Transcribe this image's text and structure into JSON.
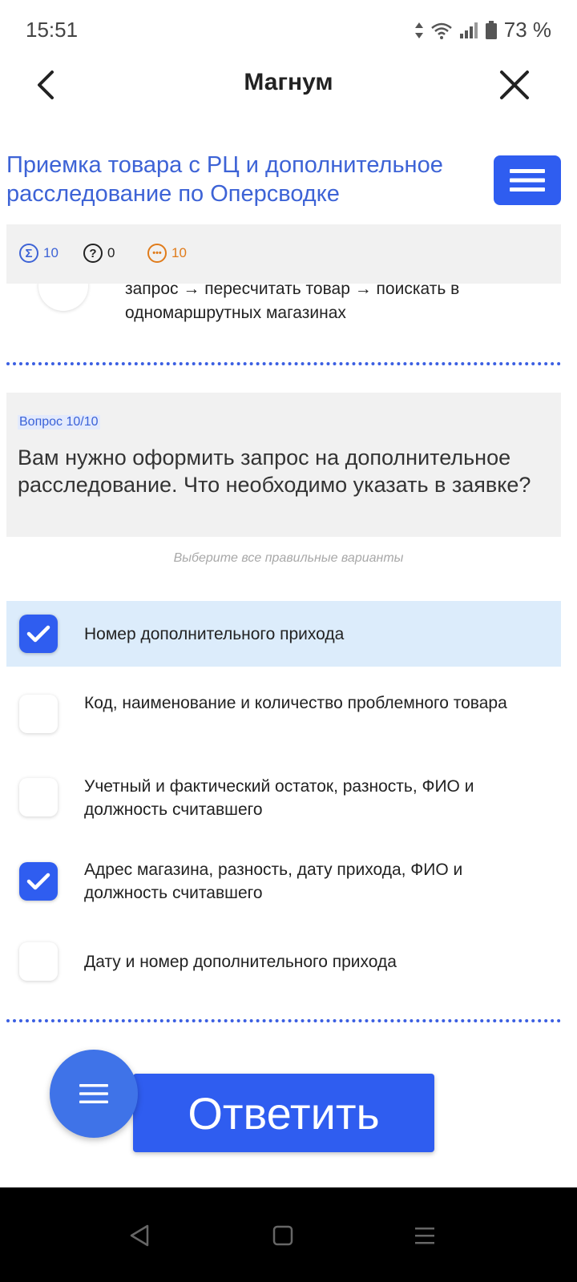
{
  "status_bar": {
    "time": "15:51",
    "battery": "73 %"
  },
  "header": {
    "title": "Магнум"
  },
  "course": {
    "title": " Приемка товара с РЦ и дополнительное расследование по Оперсводке"
  },
  "stats": {
    "total": "10",
    "unanswered": "0",
    "pending": "10"
  },
  "previous_answer": {
    "text": "запрос → пересчитать товар → поискать в одномаршрутных магазинах"
  },
  "question": {
    "counter": "Вопрос 10/10",
    "text": "Вам нужно оформить запрос на дополнительное расследование. Что необходимо указать в заявке?",
    "instruction": "Выберите все правильные варианты"
  },
  "options": [
    {
      "label": "Номер дополнительного прихода",
      "checked": true
    },
    {
      "label": "Код, наименование и количество проблемного товара",
      "checked": false
    },
    {
      "label": "Учетный и фактический остаток, разность, ФИО и должность считавшего",
      "checked": false
    },
    {
      "label": "Адрес магазина, разность, дату прихода, ФИО и должность считавшего",
      "checked": true
    },
    {
      "label": "Дату и номер дополнительного прихода",
      "checked": false
    }
  ],
  "actions": {
    "submit_label": "Ответить"
  },
  "colors": {
    "accent": "#2f5df0",
    "selected_background": "#dcecfb",
    "title_blue": "#3d63d6",
    "pending_orange": "#e07b1a"
  }
}
